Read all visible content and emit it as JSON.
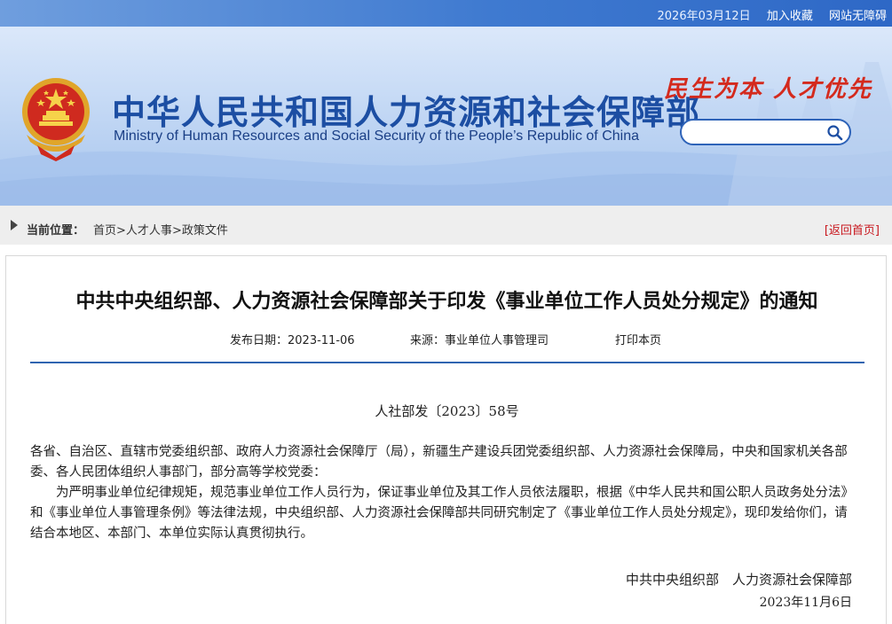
{
  "topbar": {
    "date": "2026年03月12日",
    "favorite": "加入收藏",
    "accessibility": "网站无障碍"
  },
  "banner": {
    "title_cn": "中华人民共和国人力资源和社会保障部",
    "title_en": "Ministry of Human Resources and Social Security of the People’s Republic of China",
    "slogan": "民生为本 人才优先",
    "search_placeholder": ""
  },
  "breadcrumb": {
    "label": "当前位置：",
    "path": [
      "首页",
      "人才人事",
      "政策文件"
    ],
    "separator": ">",
    "back": "[返回首页]"
  },
  "article": {
    "title": "中共中央组织部、人力资源社会保障部关于印发《事业单位工作人员处分规定》的通知",
    "publish_label": "发布日期：",
    "publish_date": "2023-11-06",
    "source_label": "来源：",
    "source": "事业单位人事管理司",
    "print": "打印本页",
    "doc_number": "人社部发〔2023〕58号",
    "recipients": "各省、自治区、直辖市党委组织部、政府人力资源社会保障厅（局），新疆生产建设兵团党委组织部、人力资源社会保障局，中央和国家机关各部委、各人民团体组织人事部门，部分高等学校党委：",
    "body": "为严明事业单位纪律规矩，规范事业单位工作人员行为，保证事业单位及其工作人员依法履职，根据《中华人民共和国公职人员政务处分法》和《事业单位人事管理条例》等法律法规，中央组织部、人力资源社会保障部共同研究制定了《事业单位工作人员处分规定》，现印发给你们，请结合本地区、本部门、本单位实际认真贯彻执行。",
    "signers": "中共中央组织部　人力资源社会保障部",
    "sign_date": "2023年11月6日"
  },
  "colors": {
    "brand_blue": "#1c4ea3",
    "slogan_red": "#d42a1d",
    "rule_blue": "#2f64b0",
    "back_red": "#c8161d"
  }
}
